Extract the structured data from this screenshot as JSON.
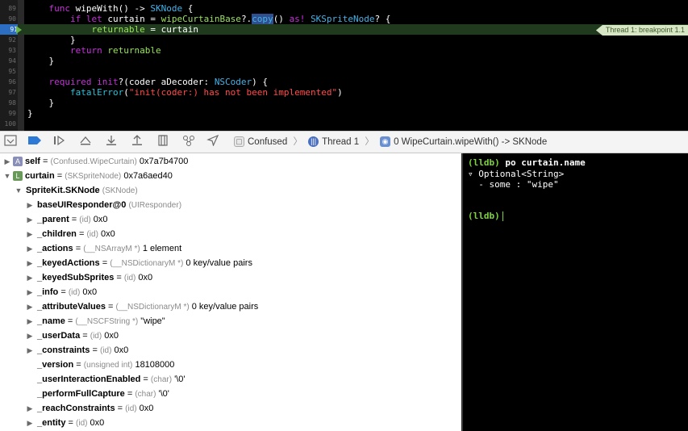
{
  "editor": {
    "lines": [
      {
        "n": "89",
        "parts": [
          [
            "plain",
            "    "
          ],
          [
            "kw",
            "func"
          ],
          [
            "plain",
            " wipeWith() -> "
          ],
          [
            "ty",
            "SKNode"
          ],
          [
            "plain",
            " {"
          ]
        ]
      },
      {
        "n": "90",
        "parts": [
          [
            "plain",
            "        "
          ],
          [
            "kw",
            "if let"
          ],
          [
            "plain",
            " curtain = "
          ],
          [
            "fn",
            "wipeCurtainBase"
          ],
          [
            "plain",
            "?."
          ],
          [
            "sel",
            "copy"
          ],
          [
            "plain",
            "() "
          ],
          [
            "kw",
            "as!"
          ],
          [
            "plain",
            " "
          ],
          [
            "ty",
            "SKSpriteNode"
          ],
          [
            "plain",
            "? {"
          ]
        ]
      },
      {
        "n": "91",
        "parts": [
          [
            "plain",
            "            "
          ],
          [
            "fn",
            "returnable"
          ],
          [
            "plain",
            " = curtain"
          ]
        ]
      },
      {
        "n": "92",
        "parts": [
          [
            "plain",
            "        }"
          ]
        ]
      },
      {
        "n": "93",
        "parts": [
          [
            "plain",
            "        "
          ],
          [
            "kw",
            "return"
          ],
          [
            "plain",
            " "
          ],
          [
            "fn",
            "returnable"
          ]
        ]
      },
      {
        "n": "94",
        "parts": [
          [
            "plain",
            "    }"
          ]
        ]
      },
      {
        "n": "95",
        "parts": [
          [
            "plain",
            ""
          ]
        ]
      },
      {
        "n": "96",
        "parts": [
          [
            "plain",
            "    "
          ],
          [
            "kw",
            "required init"
          ],
          [
            "plain",
            "?(coder aDecoder: "
          ],
          [
            "ty",
            "NSCoder"
          ],
          [
            "plain",
            ") {"
          ]
        ]
      },
      {
        "n": "97",
        "parts": [
          [
            "plain",
            "        "
          ],
          [
            "mth",
            "fatalError"
          ],
          [
            "plain",
            "("
          ],
          [
            "str",
            "\"init(coder:) has not been implemented\""
          ],
          [
            "plain",
            ")"
          ]
        ]
      },
      {
        "n": "98",
        "parts": [
          [
            "plain",
            "    }"
          ]
        ]
      },
      {
        "n": "99",
        "parts": [
          [
            "plain",
            "}"
          ]
        ]
      },
      {
        "n": "100",
        "parts": [
          [
            "plain",
            ""
          ]
        ]
      }
    ],
    "breakpoint_label": "Thread 1: breakpoint 1.1"
  },
  "debug_bar": {
    "crumbs": [
      "Confused",
      "Thread 1",
      "0 WipeCurtain.wipeWith() -> SKNode"
    ]
  },
  "variables": [
    {
      "indent": 0,
      "tri": "▶",
      "badge": "A",
      "badge_color": "#8a8fb8",
      "name": "self",
      "eq": " = ",
      "type": "(Confused.WipeCurtain)",
      "value": " 0x7a7b4700"
    },
    {
      "indent": 0,
      "tri": "▼",
      "badge": "L",
      "badge_color": "#6a9a5a",
      "name": "curtain",
      "eq": " = ",
      "type": "(SKSpriteNode)",
      "value": " 0x7a6aed40"
    },
    {
      "indent": 1,
      "tri": "▼",
      "badge": "",
      "name": "SpriteKit.SKNode",
      "eq": " ",
      "type": "(SKNode)",
      "value": ""
    },
    {
      "indent": 2,
      "tri": "▶",
      "badge": "",
      "name": "baseUIResponder@0",
      "eq": " ",
      "type": "(UIResponder)",
      "value": ""
    },
    {
      "indent": 2,
      "tri": "▶",
      "badge": "",
      "name": "_parent",
      "eq": " = ",
      "type": "(id)",
      "value": " 0x0"
    },
    {
      "indent": 2,
      "tri": "▶",
      "badge": "",
      "name": "_children",
      "eq": " = ",
      "type": "(id)",
      "value": " 0x0"
    },
    {
      "indent": 2,
      "tri": "▶",
      "badge": "",
      "name": "_actions",
      "eq": " = ",
      "type": "(__NSArrayM *)",
      "value": " 1 element"
    },
    {
      "indent": 2,
      "tri": "▶",
      "badge": "",
      "name": "_keyedActions",
      "eq": " = ",
      "type": "(__NSDictionaryM *)",
      "value": " 0 key/value pairs"
    },
    {
      "indent": 2,
      "tri": "▶",
      "badge": "",
      "name": "_keyedSubSprites",
      "eq": " = ",
      "type": "(id)",
      "value": " 0x0"
    },
    {
      "indent": 2,
      "tri": "▶",
      "badge": "",
      "name": "_info",
      "eq": " = ",
      "type": "(id)",
      "value": " 0x0"
    },
    {
      "indent": 2,
      "tri": "▶",
      "badge": "",
      "name": "_attributeValues",
      "eq": " = ",
      "type": "(__NSDictionaryM *)",
      "value": " 0 key/value pairs"
    },
    {
      "indent": 2,
      "tri": "▶",
      "badge": "",
      "name": "_name",
      "eq": " = ",
      "type": "(__NSCFString *)",
      "value": " \"wipe\""
    },
    {
      "indent": 2,
      "tri": "▶",
      "badge": "",
      "name": "_userData",
      "eq": " = ",
      "type": "(id)",
      "value": " 0x0"
    },
    {
      "indent": 2,
      "tri": "▶",
      "badge": "",
      "name": "_constraints",
      "eq": " = ",
      "type": "(id)",
      "value": " 0x0"
    },
    {
      "indent": 2,
      "tri": "",
      "badge": "",
      "name": "_version",
      "eq": " = ",
      "type": "(unsigned int)",
      "value": " 18108000"
    },
    {
      "indent": 2,
      "tri": "",
      "badge": "",
      "name": "_userInteractionEnabled",
      "eq": " = ",
      "type": "(char)",
      "value": " '\\0'"
    },
    {
      "indent": 2,
      "tri": "",
      "badge": "",
      "name": "_performFullCapture",
      "eq": " = ",
      "type": "(char)",
      "value": " '\\0'"
    },
    {
      "indent": 2,
      "tri": "▶",
      "badge": "",
      "name": "_reachConstraints",
      "eq": " = ",
      "type": "(id)",
      "value": " 0x0"
    },
    {
      "indent": 2,
      "tri": "▶",
      "badge": "",
      "name": "_entity",
      "eq": " = ",
      "type": "(id)",
      "value": " 0x0"
    }
  ],
  "console": {
    "prompt": "(lldb)",
    "command": " po curtain.name",
    "output_1": "▿ Optional<String>",
    "output_2": "  - some : \"wipe\""
  }
}
